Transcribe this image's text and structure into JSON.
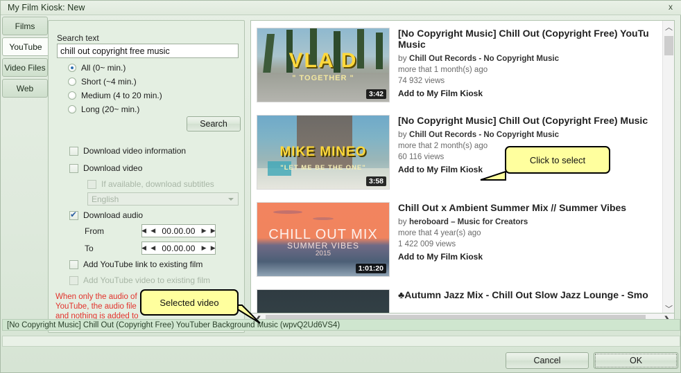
{
  "window": {
    "title": "My Film Kiosk: New",
    "close_label": "x"
  },
  "tabs": [
    {
      "label": "Films",
      "selected": false
    },
    {
      "label": "YouTube",
      "selected": true
    },
    {
      "label": "Video Files",
      "selected": false
    },
    {
      "label": "Web",
      "selected": false
    }
  ],
  "search_panel": {
    "search_text_label": "Search text",
    "search_text_value": "chill out copyright free music",
    "search_text_placeholder": "",
    "duration_options": [
      {
        "label": "All (0~ min.)",
        "selected": true
      },
      {
        "label": "Short (~4 min.)",
        "selected": false
      },
      {
        "label": "Medium (4 to 20 min.)",
        "selected": false
      },
      {
        "label": "Long (20~ min.)",
        "selected": false
      }
    ],
    "search_button": "Search",
    "checkboxes": [
      {
        "label": "Download video information",
        "checked": false,
        "disabled": false
      },
      {
        "label": "Download video",
        "checked": false,
        "disabled": false
      },
      {
        "label": "If available, download subtitles",
        "checked": false,
        "disabled": true
      },
      {
        "label": "Download audio",
        "checked": true,
        "disabled": false
      },
      {
        "label": "Add YouTube link to existing film",
        "checked": false,
        "disabled": false
      },
      {
        "label": "Add YouTube video to existing film",
        "checked": false,
        "disabled": true
      }
    ],
    "language_combo_value": "English",
    "from_label": "From",
    "from_value": "00.00.00",
    "to_label": "To",
    "to_value": "00.00.00",
    "warning_line1": "When only the audio of",
    "warning_line2": "YouTube, the audio file",
    "warning_line3": "and nothing is added to"
  },
  "results": [
    {
      "title": "[No Copyright Music] Chill Out (Copyright Free) YouTu",
      "title_line2": "Music",
      "by_prefix": "by",
      "channel": "Chill Out Records - No Copyright Music",
      "age": "more that 1 month(s) ago",
      "views": "74 932 views",
      "add_label": "Add to My Film Kiosk",
      "duration": "3:42",
      "thumb_title": "VLA D",
      "thumb_subtitle": "\" TOGETHER \"",
      "thumb_style": "beach"
    },
    {
      "title": "[No Copyright Music] Chill Out (Copyright Free) Music",
      "title_line2": "",
      "by_prefix": "by",
      "channel": "Chill Out Records - No Copyright Music",
      "age": "more that 2 month(s) ago",
      "views": "60 116 views",
      "add_label": "Add to My Film Kiosk",
      "duration": "3:58",
      "thumb_title": "MIKE  MINEO",
      "thumb_subtitle": "\"LET ME BE THE ONE\"",
      "thumb_style": "portrait"
    },
    {
      "title": "Chill Out x Ambient Summer Mix // Summer Vibes",
      "title_line2": "",
      "by_prefix": "by",
      "channel": "heroboard – Music for Creators",
      "age": "more that 4 year(s) ago",
      "views": "1 422 009 views",
      "add_label": "Add to My Film Kiosk",
      "duration": "1:01:20",
      "thumb_title": "CHILL OUT MIX",
      "thumb_subtitle": "SUMMER VIBES",
      "thumb_year": "2015",
      "thumb_style": "sunset"
    },
    {
      "title": "♣Autumn Jazz Mix - Chill Out Slow Jazz Lounge - Smo",
      "title_line2": "",
      "by_prefix": "",
      "channel": "",
      "age": "",
      "views": "",
      "add_label": "",
      "duration": "",
      "thumb_title": "",
      "thumb_subtitle": "",
      "thumb_style": "dark"
    }
  ],
  "callouts": [
    {
      "text": "Click to select"
    },
    {
      "text": "Selected video"
    }
  ],
  "statusbar": {
    "text": "[No Copyright Music] Chill Out (Copyright Free) YouTuber Background Music (wpvQ2Ud6VS4)"
  },
  "footer": {
    "cancel_label": "Cancel",
    "ok_label": "OK"
  },
  "colors": {
    "window_bg": "#dfeadd",
    "panel_bg": "#e4efe2",
    "status_bg": "#cfe6cf",
    "warning_text": "#e2322b",
    "callout_bg": "#ffff9e",
    "radio_dot": "#2f6fb0"
  }
}
